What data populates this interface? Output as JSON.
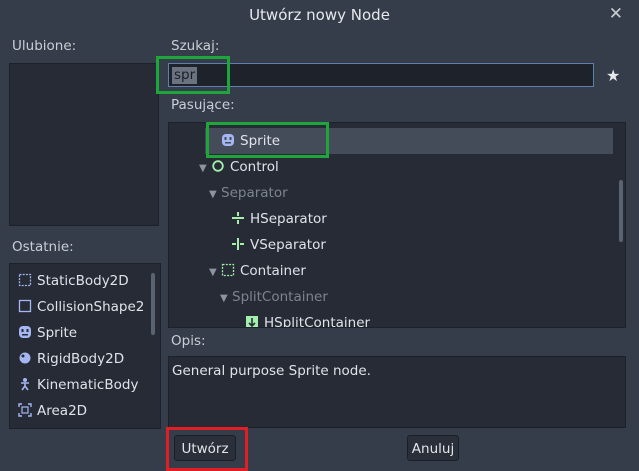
{
  "window": {
    "title": "Utwórz nowy Node"
  },
  "favorites": {
    "label": "Ulubione:"
  },
  "recent": {
    "label": "Ostatnie:",
    "items": [
      {
        "label": "StaticBody2D",
        "icon": "static-body-icon"
      },
      {
        "label": "CollisionShape2",
        "icon": "collision-shape-icon"
      },
      {
        "label": "Sprite",
        "icon": "sprite-icon"
      },
      {
        "label": "RigidBody2D",
        "icon": "rigid-body-icon"
      },
      {
        "label": "KinematicBody",
        "icon": "kinematic-body-icon"
      },
      {
        "label": "Area2D",
        "icon": "area2d-icon"
      }
    ]
  },
  "search": {
    "label": "Szukaj:",
    "value": "spr"
  },
  "matches": {
    "label": "Pasujące:",
    "items": [
      {
        "label": "Sprite",
        "icon": "sprite-icon",
        "selected": true
      },
      {
        "label": "Control",
        "icon": "control-icon",
        "expanded": true
      },
      {
        "label": "Separator",
        "dim": true,
        "expanded": true
      },
      {
        "label": "HSeparator",
        "icon": "hseparator-icon"
      },
      {
        "label": "VSeparator",
        "icon": "vseparator-icon"
      },
      {
        "label": "Container",
        "icon": "container-icon",
        "expanded": true
      },
      {
        "label": "SplitContainer",
        "dim": true,
        "expanded": true
      },
      {
        "label": "HSplitContainer",
        "icon": "hsplit-container-icon"
      }
    ]
  },
  "description": {
    "label": "Opis:",
    "text": "General purpose Sprite node."
  },
  "buttons": {
    "create": "Utwórz",
    "cancel": "Anuluj"
  },
  "colors": {
    "node_green": "#8eef97",
    "gui_green": "#a5efac",
    "sprite_blue": "#a5b7f3",
    "highlight_green": "#1fa63a",
    "highlight_red": "#df1e26"
  }
}
